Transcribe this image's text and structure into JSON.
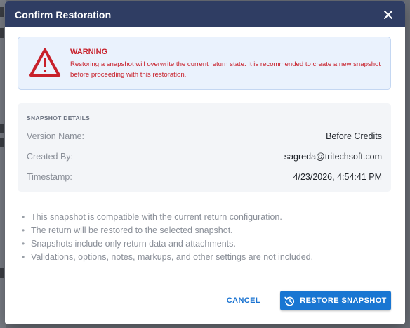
{
  "dialog": {
    "title": "Confirm Restoration"
  },
  "warning": {
    "title": "WARNING",
    "message": "Restoring a snapshot will overwrite the current return state. It is recommended to create a new snapshot before proceeding with this restoration."
  },
  "details": {
    "heading": "SNAPSHOT DETAILS",
    "rows": [
      {
        "label": "Version Name:",
        "value": "Before Credits"
      },
      {
        "label": "Created By:",
        "value": "sagreda@tritechsoft.com"
      },
      {
        "label": "Timestamp:",
        "value": "4/23/2026, 4:54:41 PM"
      }
    ]
  },
  "notes": [
    "This snapshot is compatible with the current return configuration.",
    "The return will be restored to the selected snapshot.",
    "Snapshots include only return data and attachments.",
    "Validations, options, notes, markups, and other settings are not included."
  ],
  "buttons": {
    "cancel": "CANCEL",
    "restore": "RESTORE SNAPSHOT"
  },
  "icons": {
    "close": "close-icon",
    "warning": "warning-triangle-icon",
    "restore": "history-icon"
  },
  "colors": {
    "header": "#2f3d63",
    "warning": "#c8202a",
    "primary": "#1976d2"
  }
}
